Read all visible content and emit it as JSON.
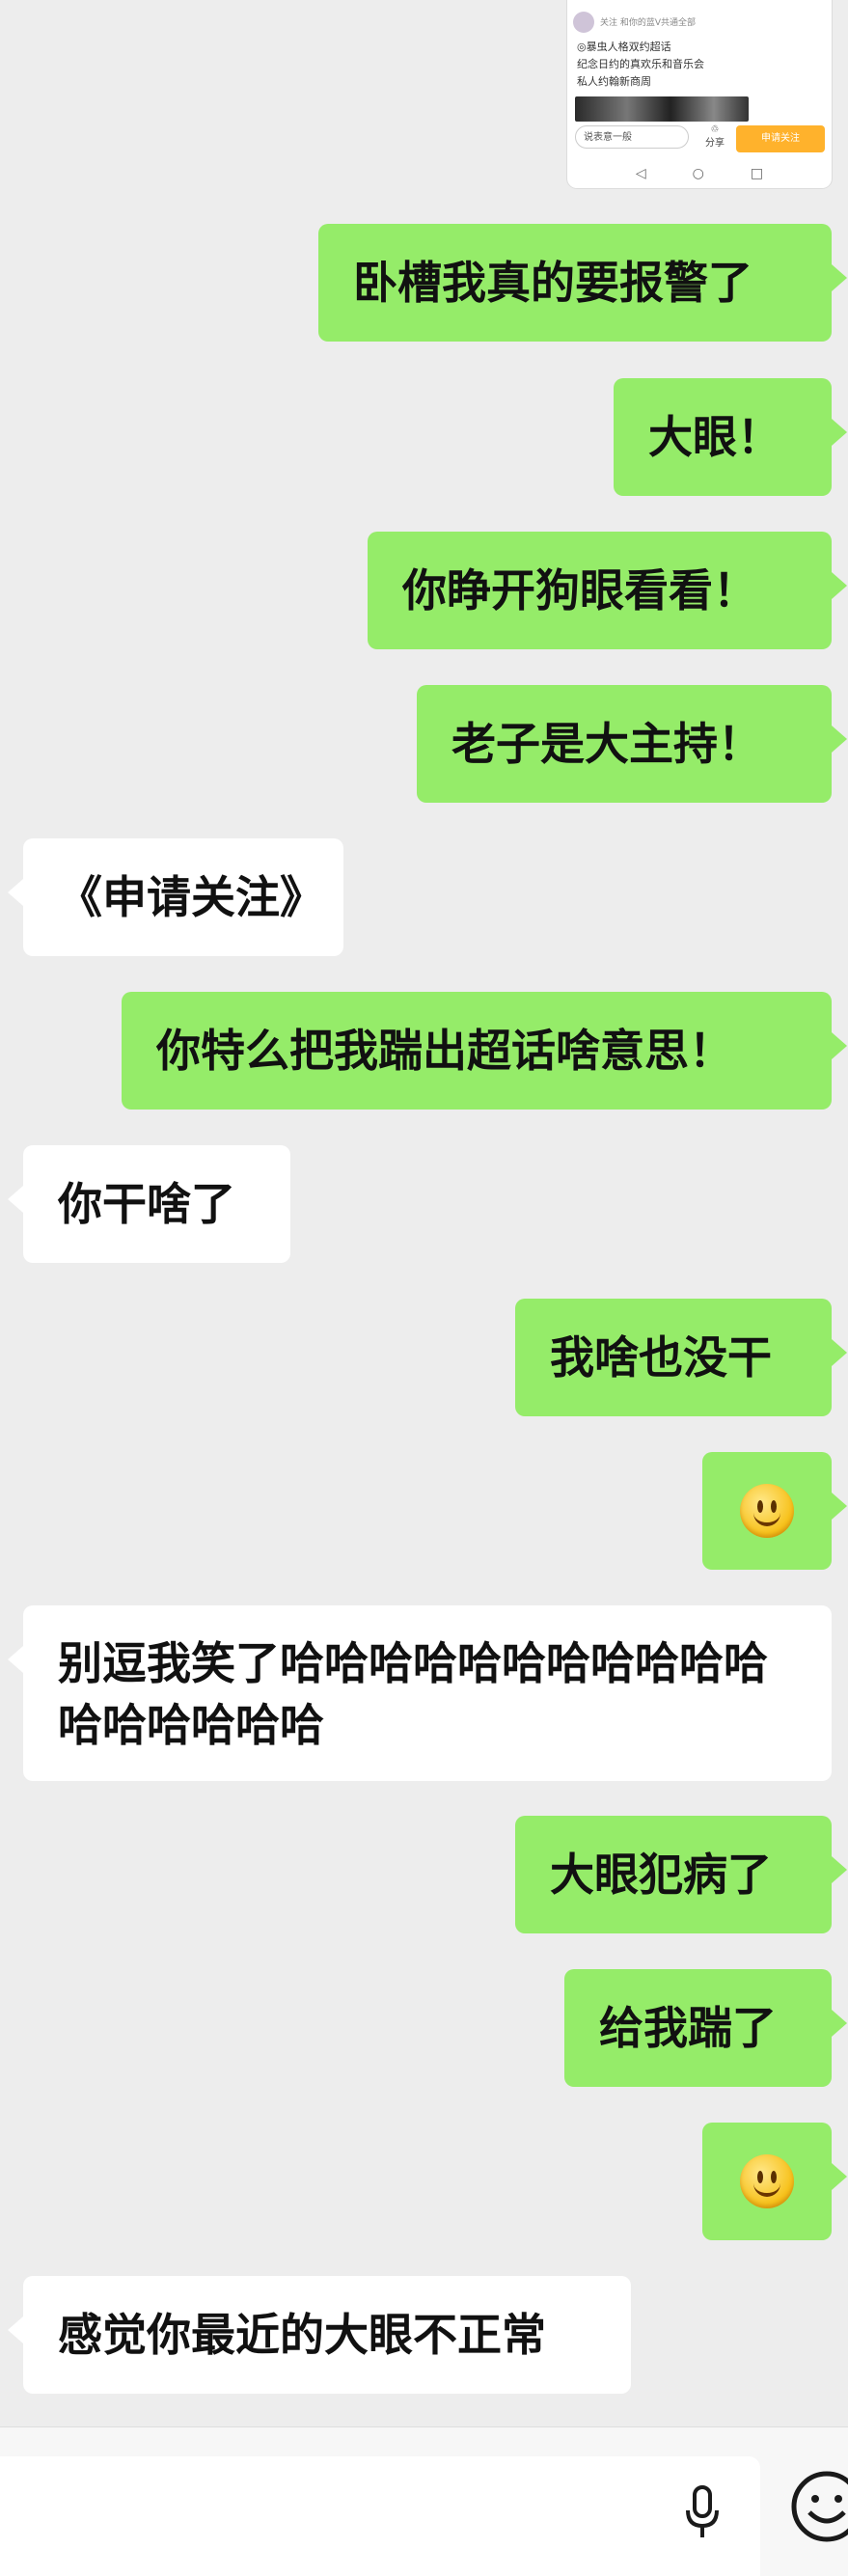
{
  "thumbnail": {
    "line1": "关注  和你的蓝V共通全部",
    "line2": "◎暴虫人格双约超话",
    "line3": "纪念日约的真欢乐和音乐会",
    "line4": "私人约翰新商周",
    "input_placeholder": "说表意一般",
    "share_label": "分享",
    "button_label": "申请关注",
    "nav": [
      "◁",
      "○",
      "□"
    ]
  },
  "messages": [
    {
      "side": "sent",
      "text": "卧槽我真的要报警了"
    },
    {
      "side": "sent",
      "text": "大眼！"
    },
    {
      "side": "sent",
      "text": "你睁开狗眼看看！"
    },
    {
      "side": "sent",
      "text": "老子是大主持！"
    },
    {
      "side": "recv",
      "text": "《申请关注》"
    },
    {
      "side": "sent",
      "text": "你特么把我踹出超话啥意思！"
    },
    {
      "side": "recv",
      "text": "你干啥了"
    },
    {
      "side": "sent",
      "text": "我啥也没干"
    },
    {
      "side": "sent",
      "emoji": "smiley-icon"
    },
    {
      "side": "recv",
      "text": "别逗我笑了哈哈哈哈哈哈哈哈哈哈哈哈哈哈哈哈哈"
    },
    {
      "side": "sent",
      "text": "大眼犯病了"
    },
    {
      "side": "sent",
      "text": "给我踹了"
    },
    {
      "side": "sent",
      "emoji": "smiley-icon"
    },
    {
      "side": "recv",
      "text": "感觉你最近的大眼不正常"
    }
  ],
  "input_bar": {
    "value": "",
    "icons": [
      "mic-icon",
      "emoji-icon"
    ]
  },
  "colors": {
    "background": "#ededed",
    "sent_bubble": "#95ec69",
    "received_bubble": "#ffffff",
    "text": "#111111"
  }
}
